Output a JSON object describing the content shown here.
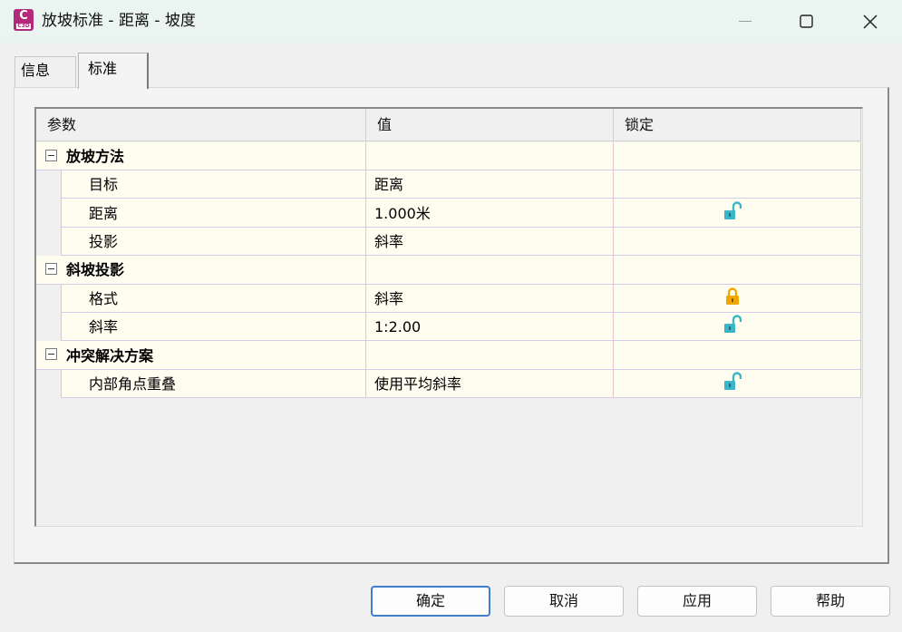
{
  "window": {
    "title": "放坡标准 - 距离 - 坡度",
    "app_badge": "C",
    "app_badge_sub": "C3D"
  },
  "tabs": [
    {
      "label": "信息",
      "active": false
    },
    {
      "label": "标准",
      "active": true
    }
  ],
  "table": {
    "columns": [
      "参数",
      "值",
      "锁定"
    ],
    "categories": [
      {
        "name": "放坡方法",
        "rows": [
          {
            "param": "目标",
            "value": "距离",
            "lock": "none"
          },
          {
            "param": "距离",
            "value": "1.000米",
            "lock": "unlocked"
          },
          {
            "param": "投影",
            "value": "斜率",
            "lock": "none"
          }
        ]
      },
      {
        "name": "斜坡投影",
        "rows": [
          {
            "param": "格式",
            "value": "斜率",
            "lock": "locked"
          },
          {
            "param": "斜率",
            "value": "1:2.00",
            "lock": "unlocked"
          }
        ]
      },
      {
        "name": "冲突解决方案",
        "rows": [
          {
            "param": "内部角点重叠",
            "value": "使用平均斜率",
            "lock": "unlocked"
          }
        ]
      }
    ]
  },
  "colors": {
    "unlocked": "#3ab6c8",
    "locked": "#f0a800",
    "row_bg": "#fffdf0",
    "primary_border": "#3f7fcc"
  },
  "buttons": {
    "ok": "确定",
    "cancel": "取消",
    "apply": "应用",
    "help": "帮助"
  }
}
